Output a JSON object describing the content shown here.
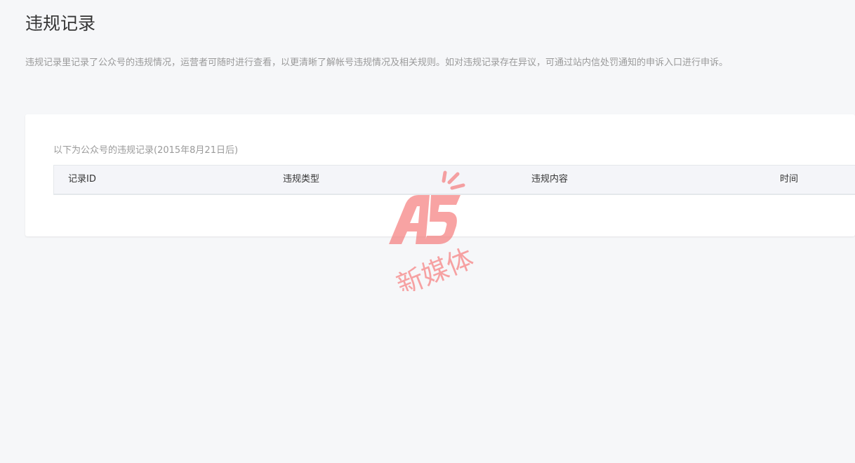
{
  "page": {
    "title": "违规记录",
    "description": "违规记录里记录了公众号的违规情况，运营者可随时进行查看，以更清晰了解帐号违规情况及相关规则。如对违规记录存在异议，可通过站内信处罚通知的申诉入口进行申诉。"
  },
  "records": {
    "caption": "以下为公众号的违规记录(2015年8月21日后)",
    "columns": [
      "记录ID",
      "违规类型",
      "违规内容",
      "时间"
    ],
    "rows": []
  },
  "watermark": {
    "logo_text": "A5",
    "sub_text": "新媒体",
    "color": "#f56c6c"
  },
  "colors": {
    "background": "#f6f7f9",
    "card": "#ffffff",
    "table_header": "#f4f5f9",
    "muted_text": "#9a9a9a"
  }
}
